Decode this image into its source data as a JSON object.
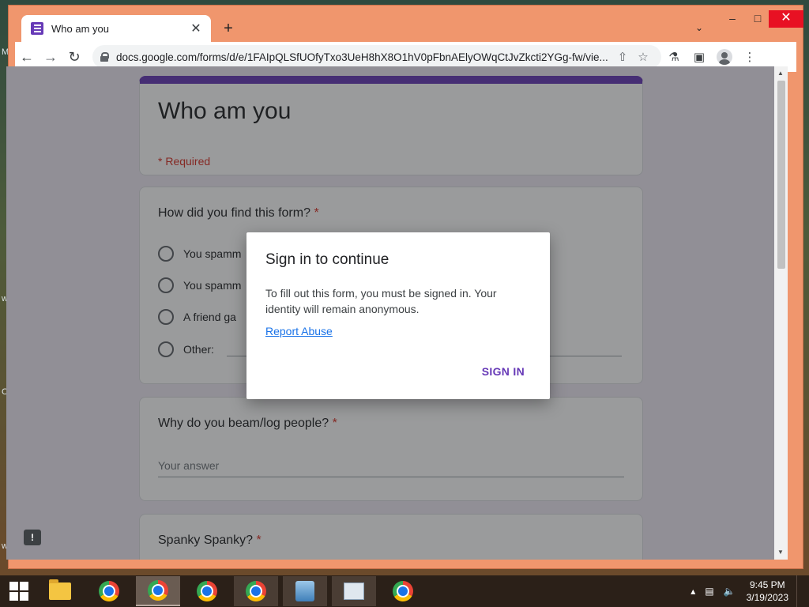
{
  "browser": {
    "tab_title": "Who am you",
    "url": "docs.google.com/forms/d/e/1FAIpQLSfUOfyTxo3UeH8hX8O1hV0pFbnAElyOWqCtJvZkcti2YGg-fw/vie...",
    "new_tab_label": "+",
    "icons": {
      "back": "←",
      "forward": "→",
      "reload": "↻",
      "share": "⇧",
      "star": "☆",
      "labs": "⚗",
      "sidepanel": "▣",
      "menu": "⋮",
      "minimize": "–",
      "maximize": "□",
      "close": "✕",
      "tab_close": "✕",
      "tab_search": "⌄"
    }
  },
  "form": {
    "title": "Who am you",
    "required_note": "* Required",
    "questions": [
      {
        "title": "How did you find this form?",
        "required_mark": "*",
        "options": [
          "You spamm",
          "You spamm",
          "A friend ga",
          "Other:"
        ]
      },
      {
        "title": "Why do you beam/log people?",
        "required_mark": "*",
        "placeholder": "Your answer"
      },
      {
        "title": "Spanky Spanky?",
        "required_mark": "*"
      }
    ]
  },
  "dialog": {
    "title": "Sign in to continue",
    "body": "To fill out this form, you must be signed in. Your identity will remain anonymous.",
    "link": "Report Abuse",
    "button": "SIGN IN"
  },
  "feedback_icon_glyph": "!",
  "taskbar": {
    "time": "9:45 PM",
    "date": "3/19/2023"
  },
  "desktop_fragments": [
    "M",
    "w",
    "C",
    "w"
  ],
  "colors": {
    "accent": "#673ab7",
    "required": "#d93025",
    "link": "#1a73e8",
    "frame": "#f0966d"
  }
}
